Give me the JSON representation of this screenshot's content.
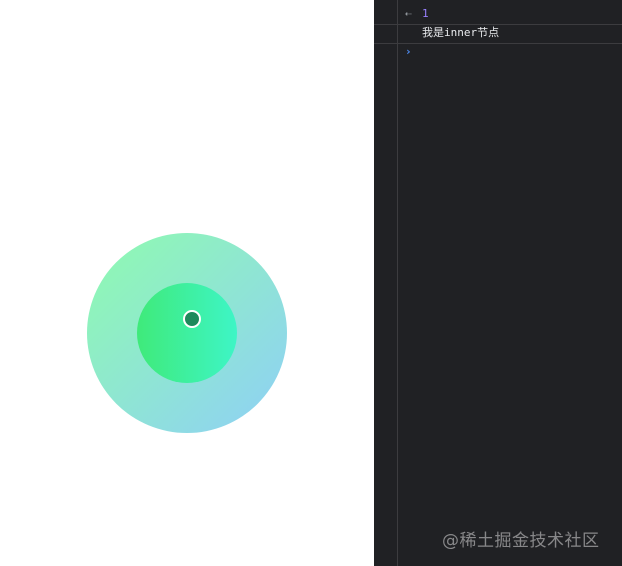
{
  "stage": {
    "outer_circle": {
      "gradient_from": "#8ff5b9",
      "gradient_to": "#8fd6ec"
    },
    "inner_circle": {
      "gradient_from": "#3fea7a",
      "gradient_to": "#3ef5c6"
    },
    "center_dot": {
      "fill": "#1e8a5c",
      "border": "#ffffff"
    }
  },
  "console": {
    "rows": [
      {
        "icon": "return-arrow-icon",
        "glyph": "⇠",
        "text": "1"
      },
      {
        "icon": "",
        "glyph": "",
        "text": "我是inner节点"
      },
      {
        "icon": "prompt-chevron-icon",
        "glyph": "›",
        "text": ""
      }
    ]
  },
  "watermark": {
    "text": "@稀土掘金技术社区"
  },
  "colors": {
    "console_background": "#202124",
    "return_value": "#9980ff",
    "prompt": "#4e8ef7"
  }
}
